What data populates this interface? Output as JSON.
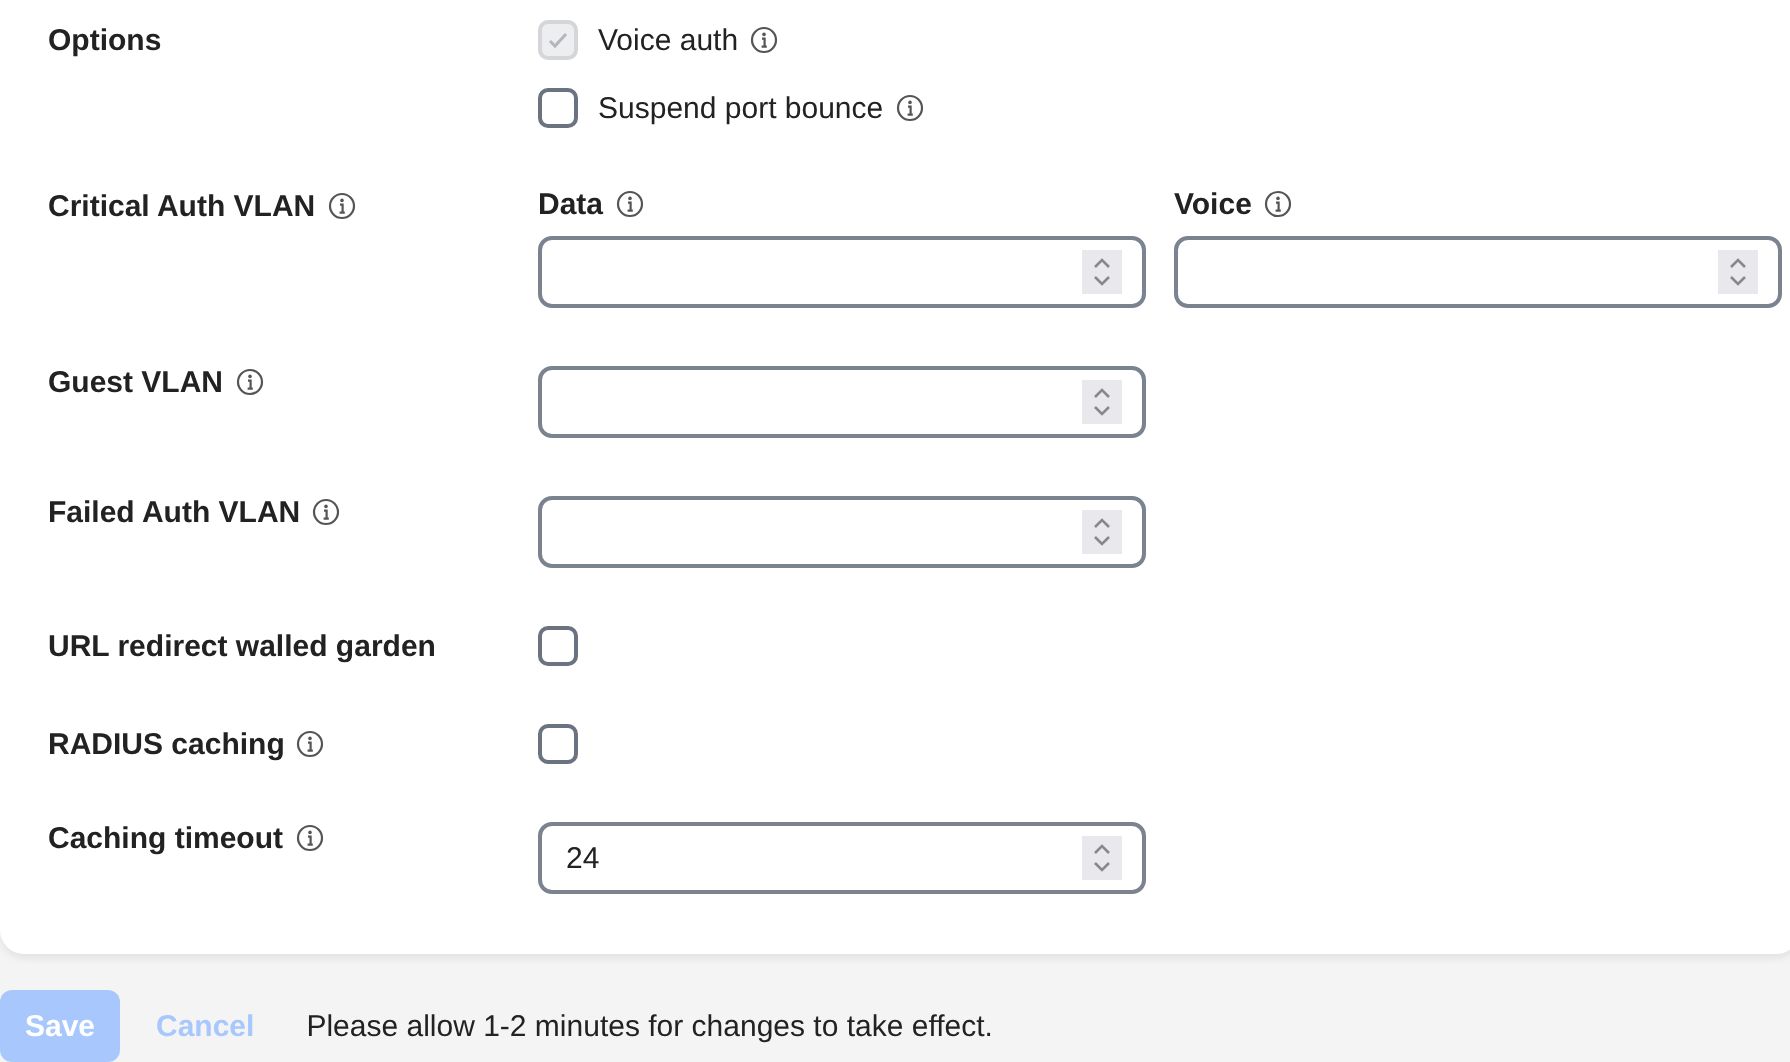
{
  "rows": [
    {
      "kind": "checkboxes",
      "label": "Options",
      "info": false,
      "options": [
        {
          "label": "Voice auth",
          "info": true,
          "checked": true,
          "disabled": true
        },
        {
          "label": "Suspend port bounce",
          "info": true,
          "checked": false,
          "disabled": false
        }
      ]
    },
    {
      "kind": "fields",
      "label": "Critical Auth VLAN",
      "info": true,
      "fields": [
        {
          "label": "Data",
          "info": true
        },
        {
          "label": "Voice",
          "info": true
        }
      ]
    },
    {
      "kind": "field",
      "label": "Guest VLAN",
      "info": true
    },
    {
      "kind": "field",
      "label": "Failed Auth VLAN",
      "info": true
    },
    {
      "kind": "checkbox",
      "label": "URL redirect walled garden",
      "info": false,
      "checked": false
    },
    {
      "kind": "checkbox",
      "label": "RADIUS caching",
      "info": true,
      "checked": false
    },
    {
      "kind": "field",
      "label": "Caching timeout",
      "info": true,
      "value": "24"
    }
  ],
  "footer": {
    "save": {
      "label": "Save",
      "disabled": true
    },
    "cancel": {
      "label": "Cancel",
      "disabled": true
    },
    "message": "Please allow 1-2 minutes for changes to take effect."
  }
}
